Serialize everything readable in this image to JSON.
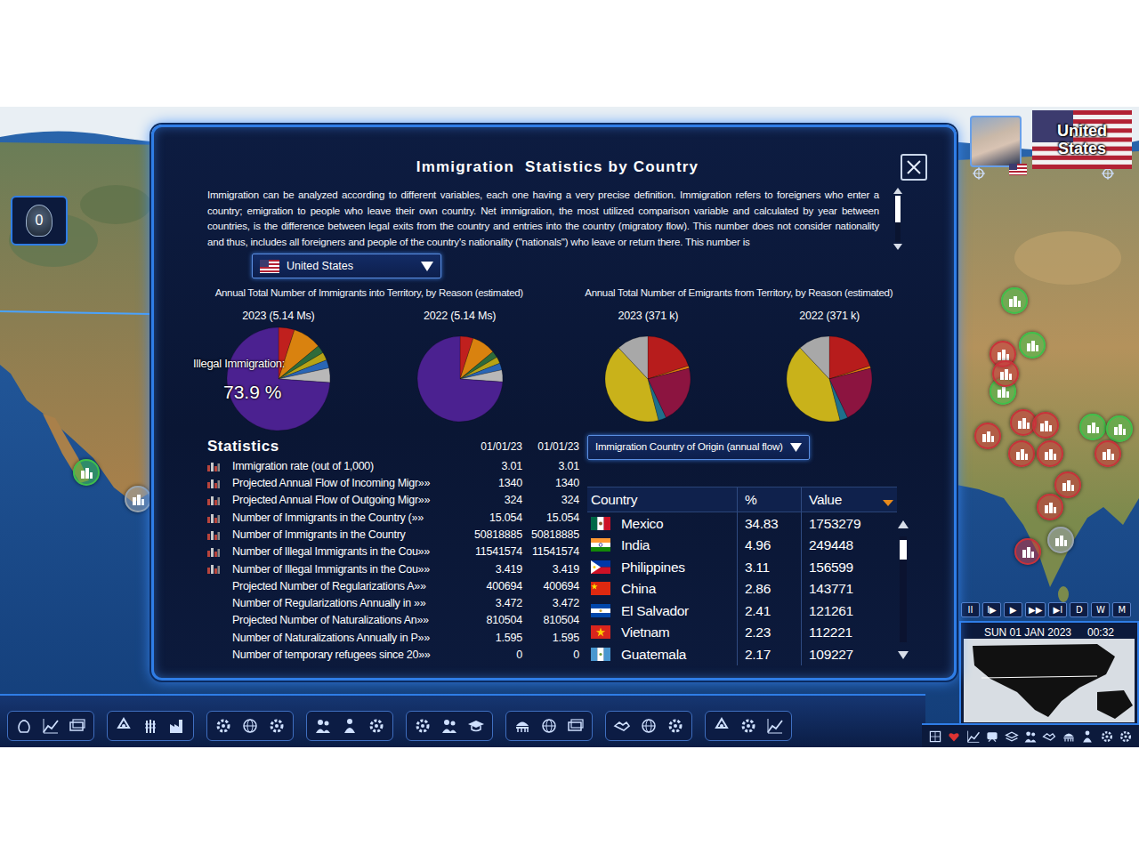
{
  "window": {
    "title": "Immigration  Statistics by Country"
  },
  "description": "Immigration can be analyzed according to different variables, each one having a very precise definition. Immigration refers to foreigners who enter a country; emigration to people who leave their own country. Net immigration, the most utilized comparison variable and calculated by year between countries, is the difference between legal exits from the country and entries into the country (migratory flow). This number does not consider nationality and thus, includes all foreigners and people of the country's nationality (\"nationals\") who leave or return there. This number is",
  "country_select": {
    "value": "United States"
  },
  "immigrants": {
    "title": "Annual Total Number of Immigrants into Territory, by Reason (estimated)",
    "tooltip": {
      "label": "Illegal Immigration:",
      "value": "73.9 %"
    },
    "pies": [
      {
        "label": "2023 (5.14 Ms)",
        "highlighted": true,
        "slices": [
          {
            "value": 5.0,
            "color": "#c0201e"
          },
          {
            "value": 9.0,
            "color": "#d9820f"
          },
          {
            "value": 2.5,
            "color": "#2f6b3a"
          },
          {
            "value": 2.5,
            "color": "#b7a316"
          },
          {
            "value": 2.6,
            "color": "#2a66b5"
          },
          {
            "value": 4.5,
            "color": "#b8b8b8"
          },
          {
            "value": 73.9,
            "color": "#4b2190"
          }
        ]
      },
      {
        "label": "2022 (5.14 Ms)",
        "highlighted": false,
        "slices": [
          {
            "value": 5.0,
            "color": "#c0201e"
          },
          {
            "value": 9.0,
            "color": "#d9820f"
          },
          {
            "value": 2.5,
            "color": "#2f6b3a"
          },
          {
            "value": 2.5,
            "color": "#b7a316"
          },
          {
            "value": 2.6,
            "color": "#2a66b5"
          },
          {
            "value": 4.5,
            "color": "#b8b8b8"
          },
          {
            "value": 73.9,
            "color": "#4b2190"
          }
        ]
      }
    ]
  },
  "emigrants": {
    "title": "Annual Total Number of Emigrants from Territory, by Reason (estimated)",
    "pies": [
      {
        "label": "2023 (371 k)",
        "highlighted": false,
        "slices": [
          {
            "value": 20,
            "color": "#b71c1c"
          },
          {
            "value": 1,
            "color": "#e07a10"
          },
          {
            "value": 22,
            "color": "#8c1440"
          },
          {
            "value": 3,
            "color": "#1f6f8b"
          },
          {
            "value": 42,
            "color": "#c9b21a"
          },
          {
            "value": 12,
            "color": "#a8a8a8"
          }
        ]
      },
      {
        "label": "2022 (371 k)",
        "highlighted": false,
        "slices": [
          {
            "value": 20,
            "color": "#b71c1c"
          },
          {
            "value": 1,
            "color": "#e07a10"
          },
          {
            "value": 22,
            "color": "#8c1440"
          },
          {
            "value": 3,
            "color": "#1f6f8b"
          },
          {
            "value": 42,
            "color": "#c9b21a"
          },
          {
            "value": 12,
            "color": "#a8a8a8"
          }
        ]
      }
    ]
  },
  "statistics": {
    "title": "Statistics",
    "columns": [
      "01/01/23",
      "01/01/23"
    ],
    "rows": [
      {
        "label": "Immigration rate (out of 1,000)",
        "values": [
          "3.01",
          "3.01"
        ],
        "chart": true
      },
      {
        "label": "Projected Annual Flow of Incoming Migr»»",
        "values": [
          "1340",
          "1340"
        ],
        "chart": true
      },
      {
        "label": "Projected Annual Flow of Outgoing Migr»»",
        "values": [
          "324",
          "324"
        ],
        "chart": true
      },
      {
        "label": "Number of Immigrants in the Country (»»",
        "values": [
          "15.054",
          "15.054"
        ],
        "chart": true
      },
      {
        "label": "Number of Immigrants in the Country",
        "values": [
          "50818885",
          "50818885"
        ],
        "chart": true
      },
      {
        "label": "Number of Illegal Immigrants in the Cou»»",
        "values": [
          "11541574",
          "11541574"
        ],
        "chart": true
      },
      {
        "label": "Number of Illegal Immigrants in the Cou»»",
        "values": [
          "3.419",
          "3.419"
        ],
        "chart": true
      },
      {
        "label": "Projected Number of Regularizations A»»",
        "values": [
          "400694",
          "400694"
        ],
        "chart": false
      },
      {
        "label": "Number of Regularizations Annually in »»",
        "values": [
          "3.472",
          "3.472"
        ],
        "chart": false
      },
      {
        "label": "Projected Number of Naturalizations An»»",
        "values": [
          "810504",
          "810504"
        ],
        "chart": false
      },
      {
        "label": "Number of Naturalizations Annually in P»»",
        "values": [
          "1.595",
          "1.595"
        ],
        "chart": false
      },
      {
        "label": "Number of temporary refugees since 20»»",
        "values": [
          "0",
          "0"
        ],
        "chart": false
      }
    ]
  },
  "origin": {
    "dropdown": "Immigration Country of Origin (annual flow)",
    "columns": [
      "Country",
      "%",
      "Value"
    ],
    "rows": [
      {
        "country": "Mexico",
        "percent": "34.83",
        "value": "1753279"
      },
      {
        "country": "India",
        "percent": "4.96",
        "value": "249448"
      },
      {
        "country": "Philippines",
        "percent": "3.11",
        "value": "156599"
      },
      {
        "country": "China",
        "percent": "2.86",
        "value": "143771"
      },
      {
        "country": "El Salvador",
        "percent": "2.41",
        "value": "121261"
      },
      {
        "country": "Vietnam",
        "percent": "2.23",
        "value": "112221"
      },
      {
        "country": "Guatemala",
        "percent": "2.17",
        "value": "109227"
      }
    ]
  },
  "hud": {
    "country": "United States",
    "counter": "0",
    "time_controls": [
      "II",
      "I▶",
      "▶",
      "▶▶",
      "▶I",
      "D",
      "W",
      "M"
    ],
    "date": "SUN 01 JAN 2023",
    "time": "00:32"
  },
  "map_pins": [
    {
      "color": "#3fbf4a"
    },
    {
      "color": "#9aa4ad"
    },
    {
      "color": "#3fbf4a"
    },
    {
      "color": "#c8323a"
    },
    {
      "color": "#3fbf4a"
    },
    {
      "color": "#3fbf4a"
    },
    {
      "color": "#c8323a"
    },
    {
      "color": "#c8323a"
    },
    {
      "color": "#3fbf4a"
    },
    {
      "color": "#3fbf4a"
    },
    {
      "color": "#c8323a"
    },
    {
      "color": "#c8323a"
    },
    {
      "color": "#c8323a"
    },
    {
      "color": "#c8323a"
    },
    {
      "color": "#c8323a"
    },
    {
      "color": "#c8323a"
    },
    {
      "color": "#c8323a"
    },
    {
      "color": "#9aa4ad"
    },
    {
      "color": "#c8323a"
    }
  ]
}
